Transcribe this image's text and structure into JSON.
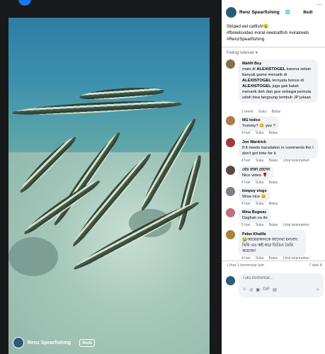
{
  "video": {
    "author": "Renz Spearfishing",
    "dot": "·",
    "follow_label": "Ikuti"
  },
  "post": {
    "author": "Renz Spearfishing",
    "globe": "🌐",
    "dot": "·",
    "follow_label": "Ikuti",
    "caption_line1": "Striped eel catfish!😮",
    "caption_line2": "#fbreelsvideo #viral #eelcatfish #viralreels",
    "caption_line3": "#RenzSpearfishing",
    "sort_label": "Paling relevan ▾"
  },
  "comments": [
    {
      "author": "Mahfii Boy",
      "text_pre": "main di ",
      "text_bold1": "ALEXISTOGEL",
      "text_mid1": " karena selain banyak game menarik di ",
      "text_bold2": "ALEXISTOGEL",
      "text_mid2": " ternyata bonus di ",
      "text_bold3": "ALEXISTOGEL",
      "text_post": " juga gak kalah menarik deh dan gue sebagai pemula udah bisa langsung tembuh JP jutaan",
      "time": "1 menit",
      "like": "Suka",
      "reply": "Balas",
      "avatar_color": "#8a6d4f"
    },
    {
      "author": "MG Iodice",
      "text": "Yummy? 😊 yes ?",
      "time": "4 hari",
      "like": "Suka",
      "reply": "Balas",
      "avatar_color": "#b07a48"
    },
    {
      "author": "Jon Wardrick",
      "text": "If it needs translation in comments the I don't got time for it",
      "time": "4 hari",
      "like": "Suka",
      "reply": "Balas",
      "translate": "Lihat terjemahan",
      "avatar_color": "#a13a3a"
    },
    {
      "author": "মোঃ রাজা হোসেন",
      "text": "Nice video 🌹",
      "time": "4 hari",
      "like": "Suka",
      "reply": "Balas",
      "avatar_color": "#5b4a3e"
    },
    {
      "author": "kimpoy vlogs",
      "text": "Wow nice 😊",
      "time": "4 hari",
      "like": "Suka",
      "reply": "Balas",
      "avatar_color": "#7d7f8a"
    },
    {
      "author": "Mina Bugwac",
      "text": "Daghan sa ito",
      "time": "5 hari",
      "like": "Suka",
      "reply": "Balas",
      "translate": "Lihat terjemahan",
      "avatar_color": "#c0707a"
    },
    {
      "author": "Palas Khalifa",
      "text": "😭আমেরাকানকে আগেথা ধন্যবাদ থিমি এত কষ্ট করে ভিডিও তৈরি করেছেন",
      "time": "4 hari",
      "like": "Suka",
      "reply": "Balas",
      "translate": "Lihat terjemahan",
      "avatar_color": "#a6823a"
    }
  ],
  "more_comments": {
    "label": "Lihat 1 komentar lain",
    "count": "7 dari 8"
  },
  "compose": {
    "placeholder": "Tulis komentar...",
    "icons": [
      "☺",
      "◎",
      "▣",
      "GIF",
      "▤"
    ],
    "send_icon": "➤"
  }
}
